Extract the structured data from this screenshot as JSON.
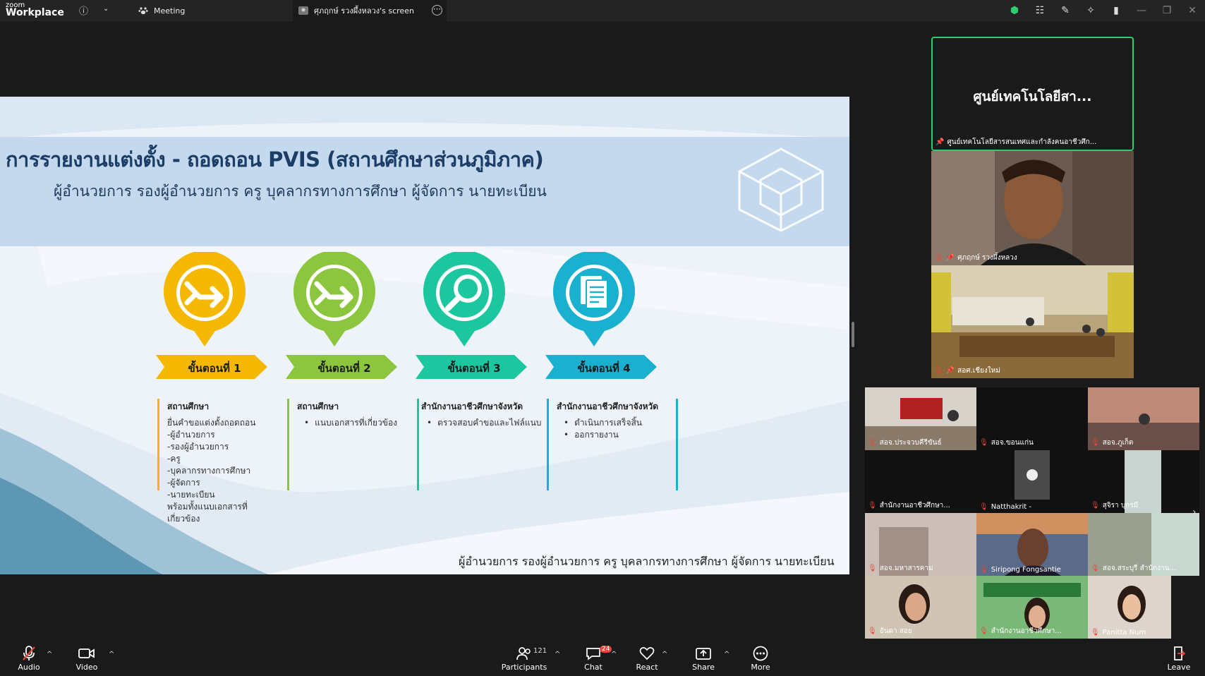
{
  "titlebar": {
    "logo_line1": "zoom",
    "logo_line2": "Workplace",
    "meeting_tab": "Meeting",
    "screen_tab": "ศุภฤกษ์ รวงผึ้งหลวง's screen"
  },
  "slide": {
    "title": "การรายงานแต่งตั้ง - ถอดถอน PVIS (สถานศึกษาส่วนภูมิภาค)",
    "subtitle": "ผู้อำนวยการ รองผู้อำนวยการ ครู บุคลากรทางการศึกษา ผู้จัดการ นายทะเบียน",
    "footer": "ผู้อำนวยการ รองผู้อำนวยการ ครู บุคลากรทางการศึกษา ผู้จัดการ นายทะเบียน",
    "steps": [
      {
        "label": "ขั้นตอนที่ 1",
        "color": "#f5b800",
        "icon": "arrow-right-icon",
        "heading": "สถานศึกษา",
        "lines": [
          "ยื่นคำขอแต่งตั้งถอดถอน",
          "-ผู้อำนวยการ",
          "-รองผู้อำนวยการ",
          "-ครู",
          "-บุคลากรทางการศึกษา",
          "-ผู้จัดการ",
          "-นายทะเบียน",
          "พร้อมทั้งแนบเอกสารที่",
          "เกี่ยวข้อง"
        ]
      },
      {
        "label": "ขั้นตอนที่ 2",
        "color": "#8cc63f",
        "icon": "arrow-right-icon",
        "heading": "สถานศึกษา",
        "lines": [
          "แนบเอกสารที่เกี่ยวข้อง"
        ]
      },
      {
        "label": "ขั้นตอนที่ 3",
        "color": "#1cc7a0",
        "icon": "search-icon",
        "heading": "สำนักงานอาชีวศึกษาจังหวัด",
        "lines": [
          "ตรวจสอบคำขอและไฟล์แนบ"
        ]
      },
      {
        "label": "ขั้นตอนที่ 4",
        "color": "#1ab0d0",
        "icon": "document-icon",
        "heading": "สำนักงานอาชีวศึกษาจังหวัด",
        "lines": [
          "ดำเนินการเสร็จสิ้น",
          "ออกรายงาน"
        ]
      }
    ]
  },
  "speaker": {
    "name": "ศูนย์เทคโนโลยีสา...",
    "label": "ศูนย์เทคโนโลยีสารสนเทศและกำลังคนอาชีวศึก..."
  },
  "video_tiles": [
    {
      "label": "ศุภฤกษ์ รวงผึ้งหลวง",
      "pinned": true
    },
    {
      "label": "สอศ.เชียงใหม่",
      "pinned": true
    }
  ],
  "grid_tiles": [
    {
      "label": "สอจ.ประจวบคีรีขันธ์"
    },
    {
      "label": "สอจ.ขอนแก่น"
    },
    {
      "label": "สอจ.ภูเก็ต"
    },
    {
      "label": "สำนักงานอาชีวศึกษา..."
    },
    {
      "label": "Natthakrit -"
    },
    {
      "label": "สุจิรา บุกรมี"
    },
    {
      "label": "สอจ.มหาสารคาม"
    },
    {
      "label": "Siripong Fongsantie"
    },
    {
      "label": "สอจ.สระบุรี สำนักงาน..."
    },
    {
      "label": "อันดา สอย"
    },
    {
      "label": "สำนักงานอาชีวศึกษา..."
    },
    {
      "label": "Panitta Num"
    }
  ],
  "toolbar": {
    "audio": "Audio",
    "video": "Video",
    "participants": "Participants",
    "participants_count": "121",
    "chat": "Chat",
    "chat_badge": "24",
    "react": "React",
    "share": "Share",
    "more": "More",
    "leave": "Leave"
  },
  "colors": {
    "accent_green": "#2ecc71",
    "leave_red": "#e8453c"
  }
}
